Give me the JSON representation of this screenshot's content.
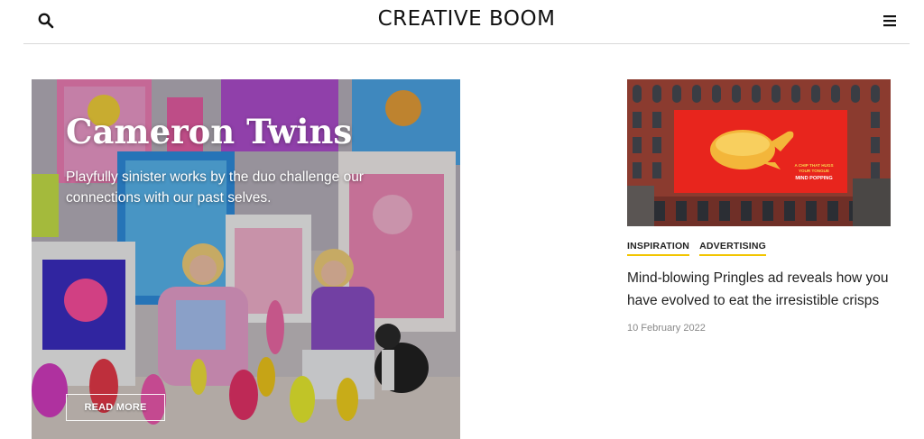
{
  "header": {
    "logo": "CREATIVE BOOM",
    "search_icon": "search-icon",
    "menu_icon": "hamburger-menu-icon"
  },
  "hero": {
    "title": "Cameron Twins",
    "description": "Playfully sinister works by the duo challenge our connections with our past selves.",
    "read_more": "READ MORE"
  },
  "side_article": {
    "tags": [
      "INSPIRATION",
      "ADVERTISING"
    ],
    "title": "Mind-blowing Pringles ad reveals how you have evolved to eat the irresistible crisps",
    "date": "10 February 2022",
    "billboard_text": [
      "A CHIP THAT HUGS",
      "YOUR TONGUE",
      "MIND POPPING"
    ]
  },
  "colors": {
    "tag_underline": "#f2c500",
    "billboard_red": "#e8251d",
    "building_brick": "#8b3b2f"
  }
}
